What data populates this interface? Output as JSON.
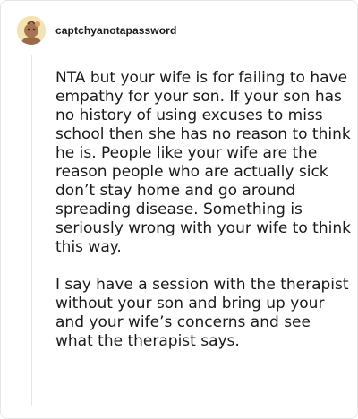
{
  "comment": {
    "username": "captchyanotapassword",
    "avatar_icon": "user-avatar-icon",
    "paragraphs": [
      "NTA but your wife is for failing to have empathy for your son. If your son has no history of using excuses to miss school then she has no reason to think he is. People like your wife are the reason people who are actually sick don’t stay home and go around spreading disease. Something is seriously wrong with your wife to think this way.",
      "I say have a session with the therapist without your son and bring up your and your wife’s concerns and see what the therapist says."
    ]
  },
  "colors": {
    "avatar_bg": "#f3e3b3",
    "text": "#1a1a1a",
    "thread_line": "#e5e5e5"
  }
}
